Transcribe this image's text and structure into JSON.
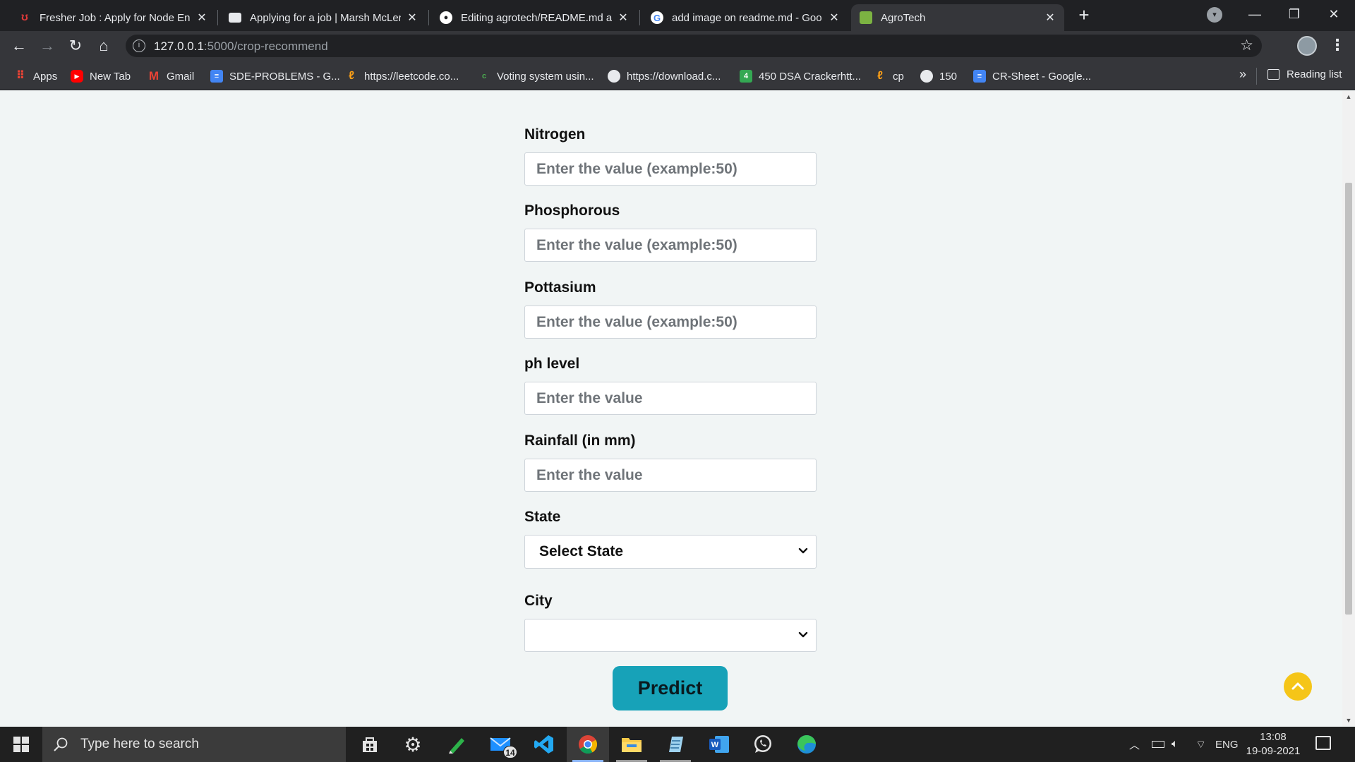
{
  "browser": {
    "tabs": [
      {
        "title": "Fresher Job : Apply for Node Eng",
        "icon": "fresher-site-icon",
        "color": "#e03a3a",
        "active": false
      },
      {
        "title": "Applying for a job | Marsh McLen",
        "icon": "briefcase-icon",
        "color": "#e8eaed",
        "active": false
      },
      {
        "title": "Editing agrotech/README.md at",
        "icon": "github-icon",
        "color": "#ffffff",
        "active": false
      },
      {
        "title": "add image on readme.md - Goo",
        "icon": "google-icon",
        "color": "#ffffff",
        "active": false
      },
      {
        "title": "AgroTech",
        "icon": "agrotech-icon",
        "color": "#7cb342",
        "active": true
      }
    ],
    "url_host": "127.0.0.1",
    "url_rest": ":5000/crop-recommend",
    "bookmarks": [
      {
        "label": "Apps",
        "icon": "apps-grid-icon",
        "color": "#ea4335"
      },
      {
        "label": "New Tab",
        "icon": "youtube-icon",
        "color": "#ff0000"
      },
      {
        "label": "Gmail",
        "icon": "gmail-icon",
        "color": "#ea4335"
      },
      {
        "label": "SDE-PROBLEMS - G...",
        "icon": "google-docs-icon",
        "color": "#4285f4"
      },
      {
        "label": "https://leetcode.co...",
        "icon": "leetcode-icon",
        "color": "#ffa116"
      },
      {
        "label": "Voting system usin...",
        "icon": "site-icon",
        "color": "#4caf50"
      },
      {
        "label": "https://download.c...",
        "icon": "globe-icon",
        "color": "#e8eaed"
      },
      {
        "label": "450 DSA Crackerhtt...",
        "icon": "number-4-icon",
        "color": "#34a853"
      },
      {
        "label": "cp",
        "icon": "leetcode-icon",
        "color": "#ffa116"
      },
      {
        "label": "150",
        "icon": "globe-icon",
        "color": "#e8eaed"
      },
      {
        "label": "CR-Sheet - Google...",
        "icon": "google-docs-icon",
        "color": "#4285f4"
      }
    ],
    "reading_list": "Reading list",
    "more_bookmarks": "»"
  },
  "form": {
    "fields": [
      {
        "label": "Nitrogen",
        "placeholder": "Enter the value (example:50)"
      },
      {
        "label": "Phosphorous",
        "placeholder": "Enter the value (example:50)"
      },
      {
        "label": "Pottasium",
        "placeholder": "Enter the value (example:50)"
      },
      {
        "label": "ph level",
        "placeholder": "Enter the value"
      },
      {
        "label": "Rainfall (in mm)",
        "placeholder": "Enter the value"
      }
    ],
    "state_label": "State",
    "state_selected": "Select State",
    "city_label": "City",
    "city_selected": "",
    "predict_label": "Predict",
    "accent_color": "#17a2b8"
  },
  "taskbar": {
    "search_placeholder": "Type here to search",
    "mail_badge": "14",
    "language": "ENG",
    "time": "13:08",
    "date": "19-09-2021"
  }
}
